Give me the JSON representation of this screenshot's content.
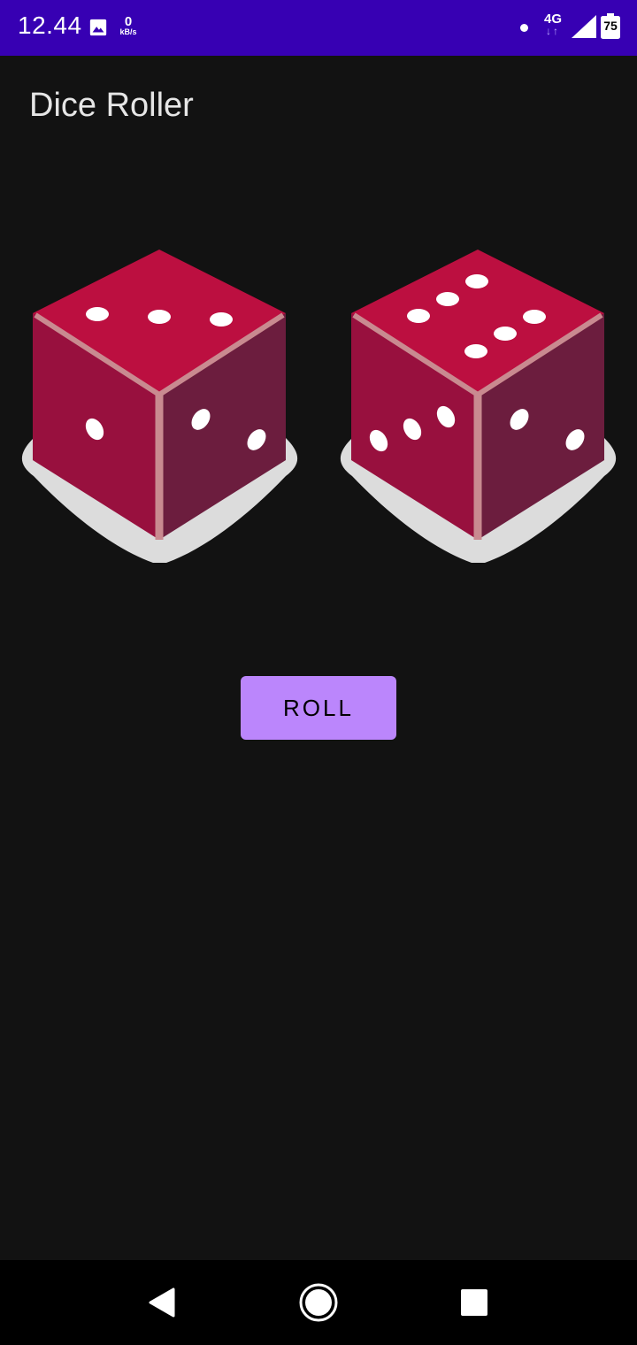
{
  "status_bar": {
    "time": "12.44",
    "net_speed_value": "0",
    "net_speed_unit": "kB/s",
    "network_type": "4G",
    "network_arrows": "↓↑",
    "battery_level": "75",
    "icons": [
      "gallery-icon",
      "notification-dot",
      "signal-icon",
      "battery-icon"
    ]
  },
  "app": {
    "title": "Dice Roller"
  },
  "dice": [
    {
      "name": "left-die",
      "top_face": 3,
      "left_face": 1,
      "right_face": 2
    },
    {
      "name": "right-die",
      "top_face": 6,
      "left_face": 3,
      "right_face": 2
    }
  ],
  "roll_button": {
    "label": "ROLL"
  },
  "nav_bar": {
    "icons": [
      "back-icon",
      "home-icon",
      "recents-icon"
    ]
  },
  "colors": {
    "status_bar": "#3700b3",
    "background": "#121212",
    "button": "#bb86fc",
    "die_top": "#bc0f40",
    "die_left": "#98103e",
    "die_right": "#6c1d3e",
    "die_edge": "#c98a90",
    "die_shadow": "#dcdcdc",
    "pip": "#ffffff"
  }
}
